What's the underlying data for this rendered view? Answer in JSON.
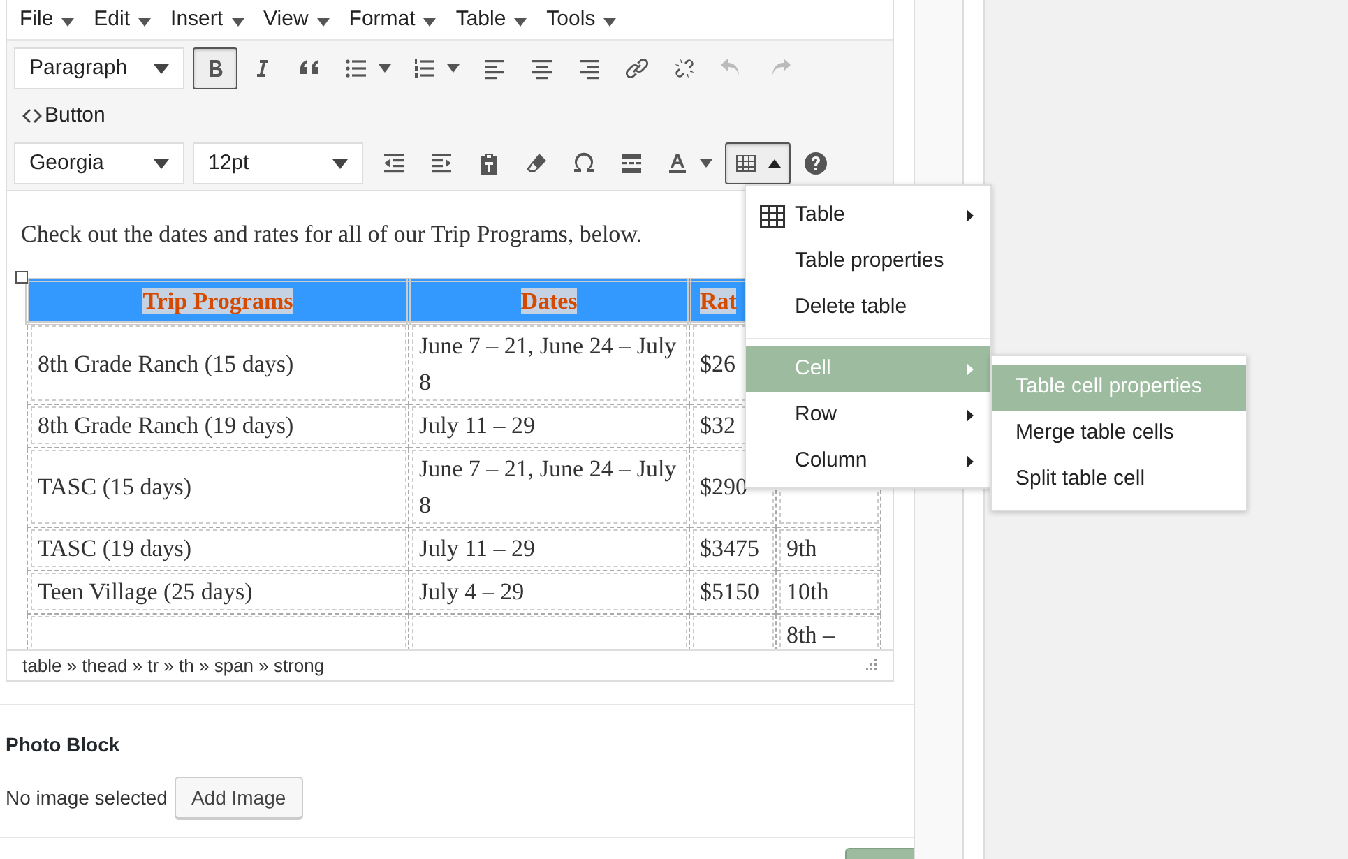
{
  "menubar": [
    {
      "label": "File"
    },
    {
      "label": "Edit"
    },
    {
      "label": "Insert"
    },
    {
      "label": "View"
    },
    {
      "label": "Format"
    },
    {
      "label": "Table"
    },
    {
      "label": "Tools"
    }
  ],
  "toolbar_rows": [
    [
      {
        "kind": "select",
        "value": "Paragraph"
      },
      {
        "kind": "bold",
        "active": true
      },
      {
        "kind": "italic",
        "active": false
      },
      {
        "kind": "quote",
        "active": false
      },
      {
        "kind": "bullets",
        "active": false
      },
      {
        "kind": "numbers",
        "active": false
      },
      {
        "kind": "align-left",
        "active": false
      },
      {
        "kind": "align-center",
        "active": false
      },
      {
        "kind": "align-right",
        "active": false
      },
      {
        "kind": "link",
        "active": false
      },
      {
        "kind": "unlink",
        "active": false
      },
      {
        "kind": "undo",
        "disabled": true
      },
      {
        "kind": "redo",
        "disabled": true
      }
    ],
    [
      {
        "kind": "text-button",
        "label": "Button"
      }
    ],
    [
      {
        "kind": "select",
        "value": "Georgia"
      },
      {
        "kind": "select",
        "value": "12pt"
      },
      {
        "kind": "outdent",
        "active": false
      },
      {
        "kind": "indent",
        "active": false
      },
      {
        "kind": "paste",
        "active": false
      },
      {
        "kind": "eraser",
        "active": false
      },
      {
        "kind": "omega",
        "active": false
      },
      {
        "kind": "readmore",
        "active": false
      },
      {
        "kind": "textcolor",
        "active": false
      },
      {
        "kind": "table",
        "active": true
      },
      {
        "kind": "help",
        "active": false
      }
    ]
  ],
  "content": {
    "paragraph": "Check out the dates and rates for all of our Trip Programs, below.",
    "table": {
      "header": [
        "Trip Programs",
        "Dates",
        "Rat"
      ],
      "rows": [
        [
          "8th Grade Ranch (15 days)",
          "June 7 – 21, June 24 – July 8",
          "$26",
          ""
        ],
        [
          "8th Grade Ranch (19 days)",
          "July 11 – 29",
          "$32",
          ""
        ],
        [
          "TASC (15 days)",
          "June 7 – 21, June 24 – July 8",
          "$290",
          ""
        ],
        [
          "TASC (19 days)",
          "July 11 – 29",
          "$3475",
          "9th"
        ],
        [
          "Teen Village (25 days)",
          "July 4 – 29",
          "$5150",
          "10th"
        ],
        [
          "",
          "",
          "",
          "8th –"
        ]
      ]
    }
  },
  "status_path": "table » thead » tr » th » span » strong",
  "context_menu": {
    "items": [
      {
        "label": "Table",
        "icon": true,
        "submenu": true,
        "selected": false
      },
      {
        "label": "Table properties",
        "submenu": false,
        "selected": false
      },
      {
        "label": "Delete table",
        "submenu": false,
        "selected": false,
        "divider_after": true
      },
      {
        "label": "Cell",
        "submenu": true,
        "selected": true
      },
      {
        "label": "Row",
        "submenu": true,
        "selected": false
      },
      {
        "label": "Column",
        "submenu": true,
        "selected": false
      }
    ],
    "submenu": [
      {
        "label": "Table cell properties",
        "selected": true
      },
      {
        "label": "Merge table cells",
        "selected": false
      },
      {
        "label": "Split table cell",
        "selected": false
      }
    ]
  },
  "photo_block": {
    "title": "Photo Block",
    "status": "No image selected",
    "button": "Add Image"
  }
}
